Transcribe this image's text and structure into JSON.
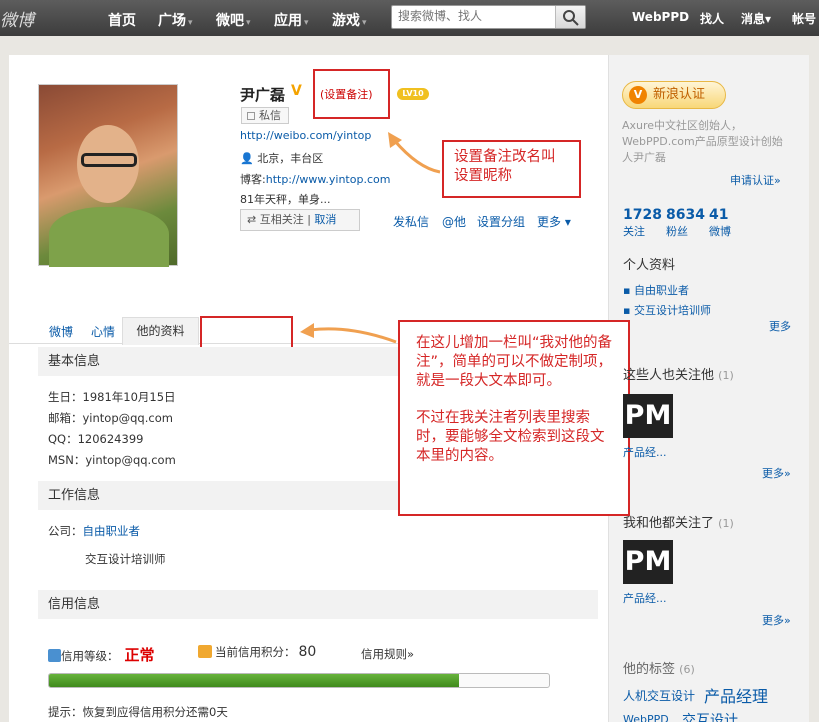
{
  "topbar": {
    "logo": "微博",
    "nav": [
      "首页",
      "广场",
      "微吧",
      "应用",
      "游戏"
    ],
    "search_placeholder": "搜索微博、找人",
    "right": [
      "WebPPD",
      "找人",
      "消息",
      "帐号"
    ]
  },
  "profile": {
    "name": "尹广磊",
    "set_note": "(设置备注)",
    "level": "LV10",
    "message": "私信",
    "url": "http://weibo.com/yintop",
    "location": "北京，丰台区",
    "blog_label": "博客:",
    "blog_url": "http://www.yintop.com",
    "bio": "81年天秤，单身...",
    "mutual": "互相关注",
    "cancel": "取消",
    "actions": [
      "发私信",
      "@他",
      "设置分组",
      "更多"
    ]
  },
  "tabs": [
    "微博",
    "心情",
    "他的资料"
  ],
  "basic": {
    "title": "基本信息",
    "birthday": "生日：1981年10月15日",
    "email": "邮箱：yintop@qq.com",
    "qq": "QQ：120624399",
    "msn": "MSN：yintop@qq.com"
  },
  "work": {
    "title": "工作信息",
    "company_label": "公司：",
    "company1": "自由职业者",
    "company2": "交互设计培训师"
  },
  "credit": {
    "title": "信用信息",
    "level_label": "信用等级：",
    "level_value": "正常",
    "score_label": "当前信用积分：",
    "score_value": "80",
    "rules": "信用规则»",
    "tip": "提示：恢复到应得信用积分还需0天",
    "progress": 0.82
  },
  "callouts": {
    "rename": "设置备注改名叫设置昵称",
    "newtab_p1": "在这儿增加一栏叫“我对他的备注”，简单的可以不做定制项，就是一段大文本即可。",
    "newtab_p2": "不过在我关注者列表里搜索时，要能够全文检索到这段文本里的内容。"
  },
  "side": {
    "badge": "新浪认证",
    "desc": "Axure中文社区创始人，WebPPD.com产品原型设计创始人尹广磊",
    "apply": "申请认证»",
    "stats": [
      {
        "n": "1728",
        "l": "关注"
      },
      {
        "n": "8634",
        "l": "粉丝"
      },
      {
        "n": "41",
        "l": "微博"
      }
    ],
    "personal_title": "个人资料",
    "personal": [
      "自由职业者",
      "交互设计培训师"
    ],
    "more": "更多",
    "also_follow_title": "这些人也关注他",
    "also_follow_count": "(1)",
    "pm_logo": "PM",
    "pm_name": "产品经...",
    "more2": "更多»",
    "common_title": "我和他都关注了",
    "common_count": "(1)",
    "tags_title": "他的标签",
    "tags_count": "(6)",
    "tags": [
      "人机交互设计",
      "产品经理",
      "WebPPD",
      "交互设计"
    ]
  },
  "colors": {
    "accent": "#0a5ba8",
    "callout": "#d52626",
    "progress": "#4f9a2a"
  }
}
